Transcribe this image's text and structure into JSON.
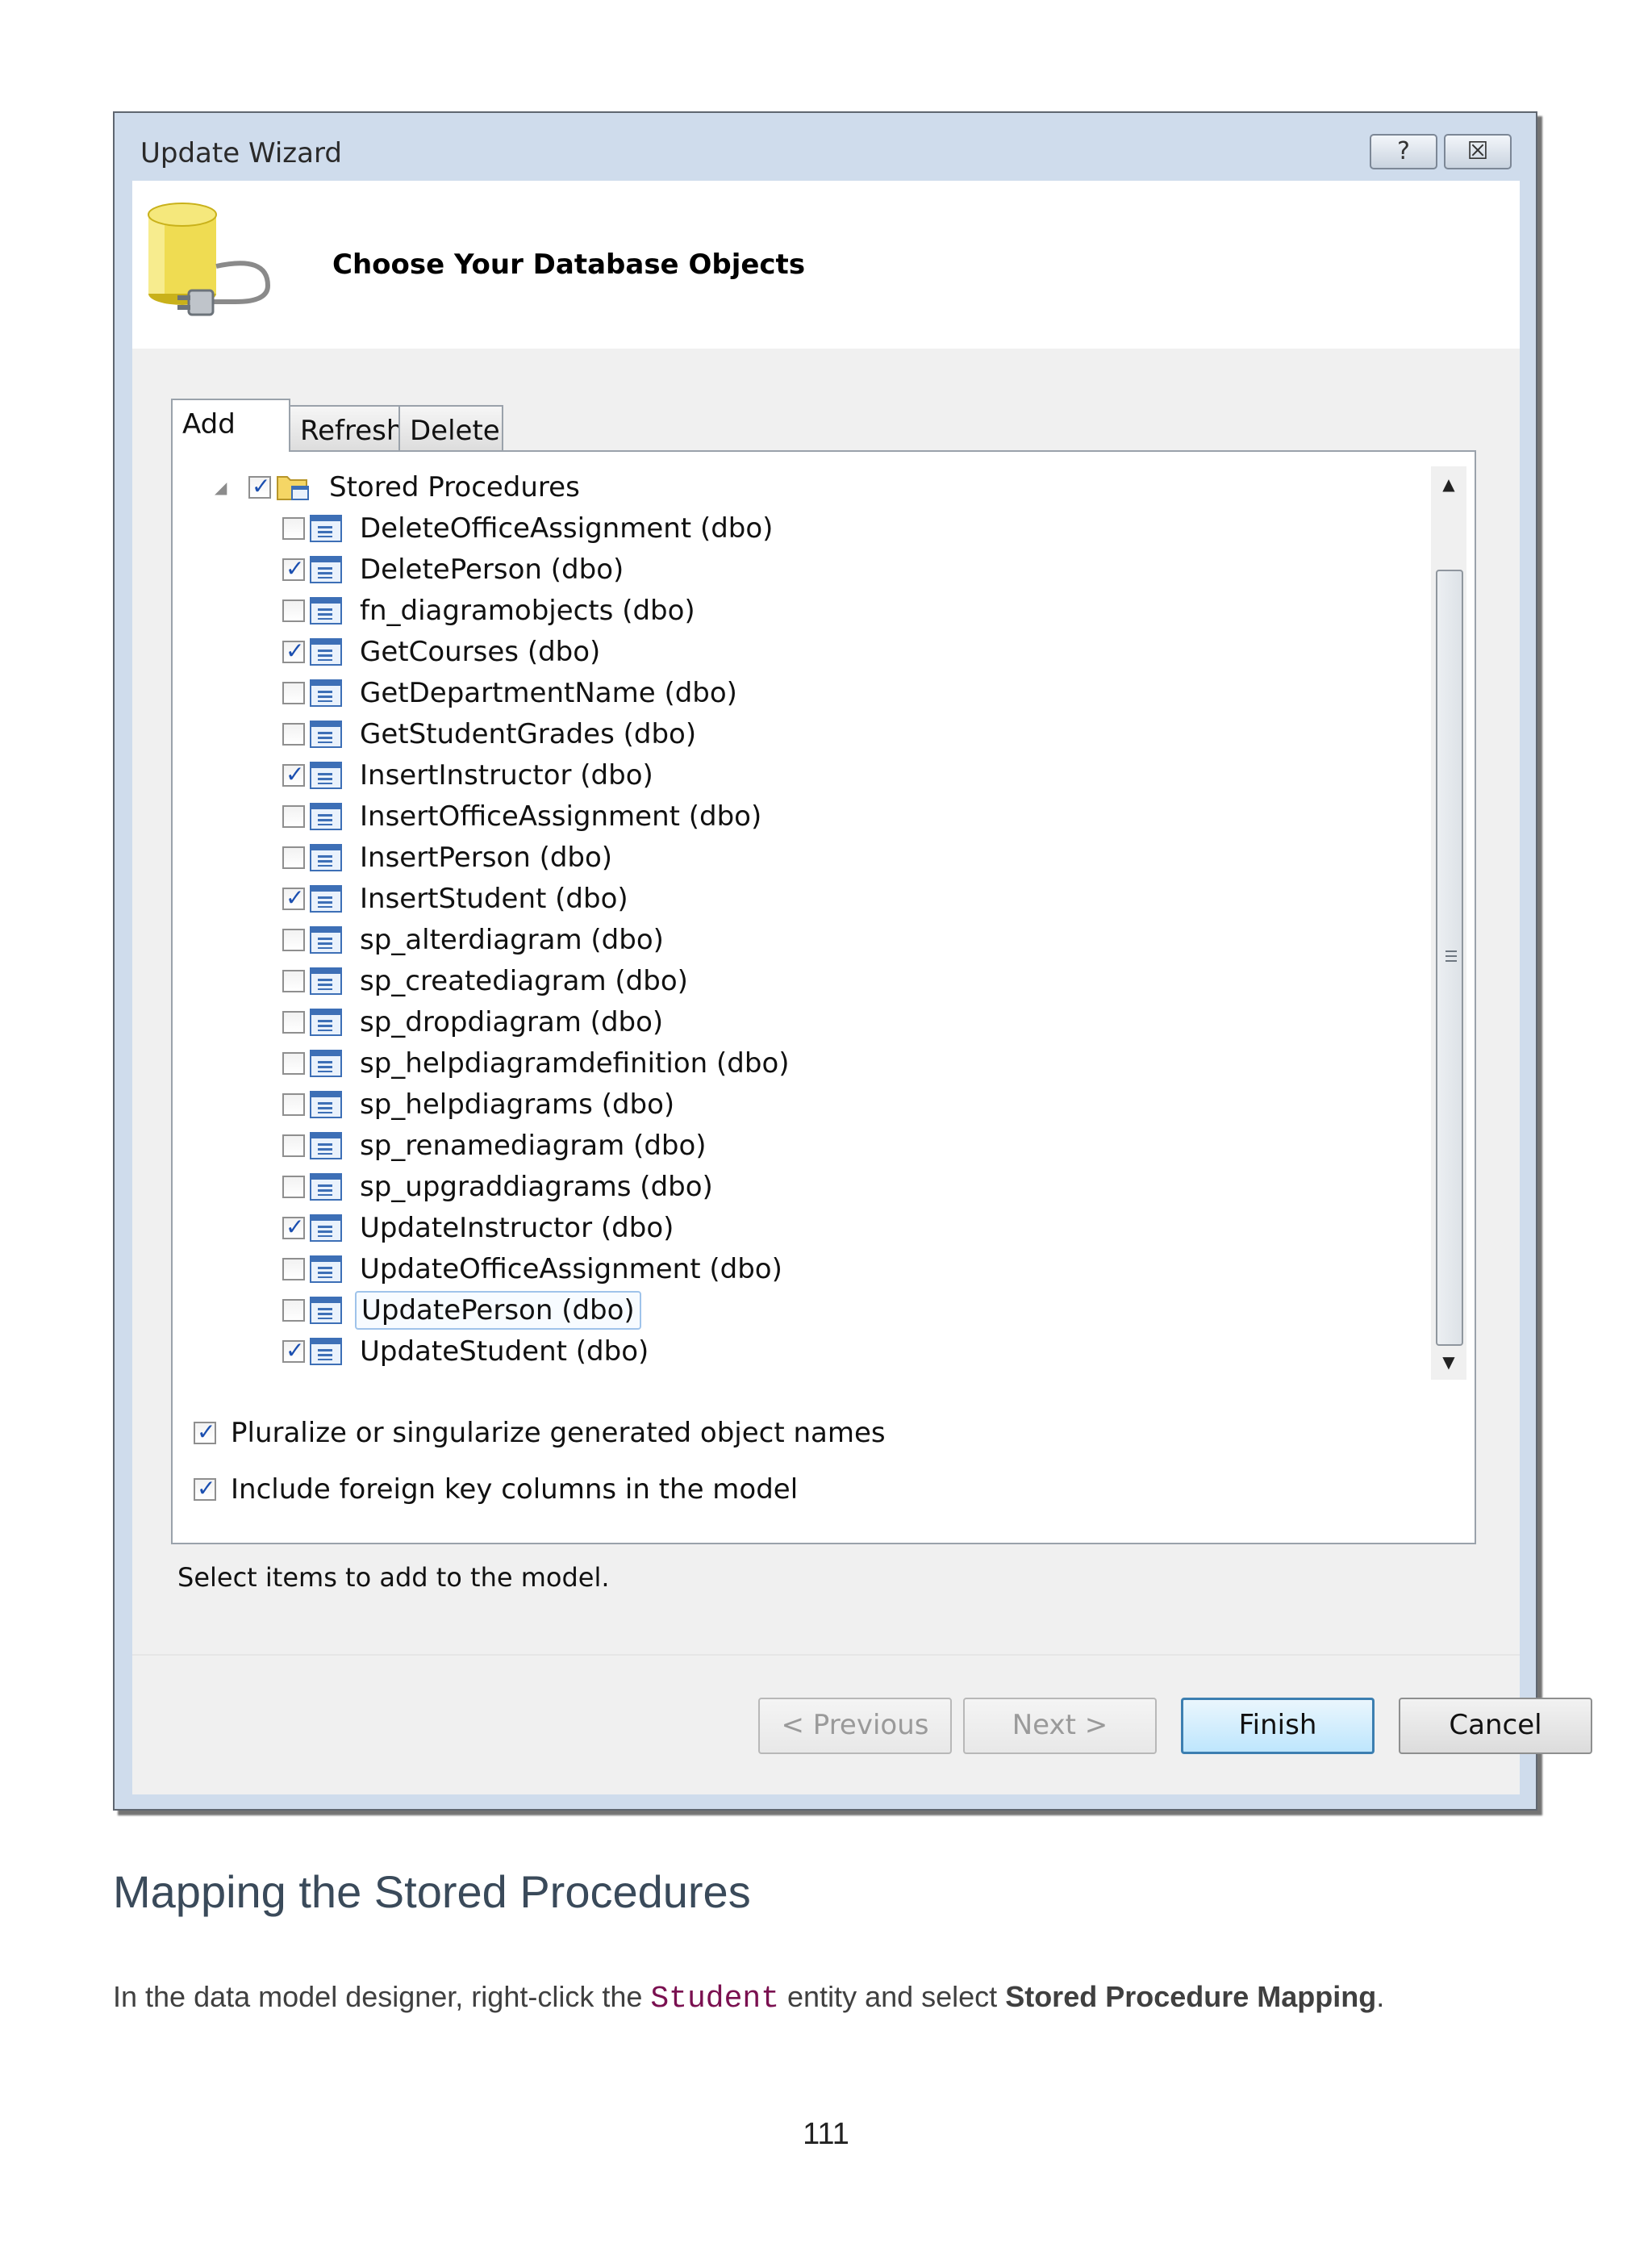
{
  "window": {
    "title": "Update Wizard",
    "help_glyph": "?",
    "close_glyph": "☒",
    "header_title": "Choose Your Database Objects"
  },
  "tabs": [
    {
      "label": "Add",
      "active": true
    },
    {
      "label": "Refresh",
      "active": false
    },
    {
      "label": "Delete",
      "active": false
    }
  ],
  "tree": {
    "root": {
      "label": "Stored Procedures",
      "checked": true,
      "expanded": true
    },
    "items": [
      {
        "label": "DeleteOfficeAssignment (dbo)",
        "checked": false
      },
      {
        "label": "DeletePerson (dbo)",
        "checked": true
      },
      {
        "label": "fn_diagramobjects (dbo)",
        "checked": false
      },
      {
        "label": "GetCourses (dbo)",
        "checked": true
      },
      {
        "label": "GetDepartmentName (dbo)",
        "checked": false
      },
      {
        "label": "GetStudentGrades (dbo)",
        "checked": false
      },
      {
        "label": "InsertInstructor (dbo)",
        "checked": true
      },
      {
        "label": "InsertOfficeAssignment (dbo)",
        "checked": false
      },
      {
        "label": "InsertPerson (dbo)",
        "checked": false
      },
      {
        "label": "InsertStudent (dbo)",
        "checked": true
      },
      {
        "label": "sp_alterdiagram (dbo)",
        "checked": false
      },
      {
        "label": "sp_creatediagram (dbo)",
        "checked": false
      },
      {
        "label": "sp_dropdiagram (dbo)",
        "checked": false
      },
      {
        "label": "sp_helpdiagramdefinition (dbo)",
        "checked": false
      },
      {
        "label": "sp_helpdiagrams (dbo)",
        "checked": false
      },
      {
        "label": "sp_renamediagram (dbo)",
        "checked": false
      },
      {
        "label": "sp_upgraddiagrams (dbo)",
        "checked": false
      },
      {
        "label": "UpdateInstructor (dbo)",
        "checked": true
      },
      {
        "label": "UpdateOfficeAssignment (dbo)",
        "checked": false
      },
      {
        "label": "UpdatePerson (dbo)",
        "checked": false,
        "selected": true
      },
      {
        "label": "UpdateStudent (dbo)",
        "checked": true
      }
    ]
  },
  "scroll": {
    "up_glyph": "▲",
    "down_glyph": "▼"
  },
  "options": [
    {
      "label": "Pluralize or singularize generated object names",
      "checked": true
    },
    {
      "label": "Include foreign key columns in the model",
      "checked": true
    }
  ],
  "status_text": "Select items to add to the model.",
  "buttons": {
    "previous": "< Previous",
    "next": "Next >",
    "finish": "Finish",
    "cancel": "Cancel"
  },
  "page": {
    "heading": "Mapping the Stored Procedures",
    "para_before": "In the data model designer, right-click the ",
    "para_code": "Student",
    "para_middle": " entity and select ",
    "para_bold": "Stored Procedure Mapping",
    "para_after": ".",
    "page_number": "111"
  }
}
